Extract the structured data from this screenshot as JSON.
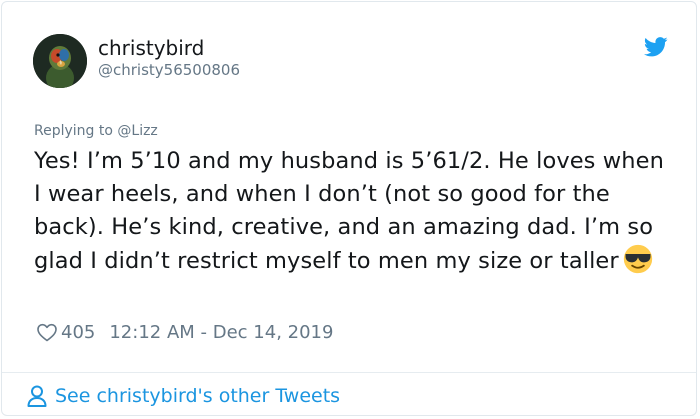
{
  "user": {
    "display_name": "christybird",
    "handle": "@christy56500806",
    "avatar_icon": "parrot-avatar"
  },
  "tweet": {
    "replying_prefix": "Replying to ",
    "replying_to": "@Lizz",
    "text": "Yes! I’m 5’10 and my husband is 5’61/2. He loves when I wear heels, and when I don’t (not so good for the back). He’s kind, creative, and an amazing dad. I’m so glad I didn’t restrict myself to men my size or taller",
    "emoji": "smiling-face-with-sunglasses",
    "likes": "405",
    "timestamp": "12:12 AM - Dec 14, 2019"
  },
  "footer": {
    "link_label": "See christybird's other Tweets"
  },
  "colors": {
    "twitter_blue": "#1da1f2",
    "link_blue": "#1b95e0",
    "secondary_text": "#657786",
    "primary_text": "#14171a"
  }
}
